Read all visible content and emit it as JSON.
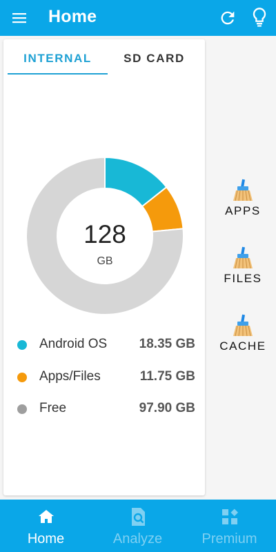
{
  "header": {
    "title": "Home",
    "menu_icon": "menu-icon",
    "refresh_icon": "refresh-icon",
    "tips_icon": "lightbulb-icon",
    "color": "#0aa7e8"
  },
  "tabs": [
    {
      "label": "INTERNAL",
      "active": true
    },
    {
      "label": "SD CARD",
      "active": false
    }
  ],
  "storage": {
    "total": "128",
    "unit": "GB",
    "segments": [
      {
        "name": "Android OS",
        "value": "18.35 GB",
        "gb": 18.35,
        "color": "#18b8d6"
      },
      {
        "name": "Apps/Files",
        "value": "11.75 GB",
        "gb": 11.75,
        "color": "#f59a0c"
      },
      {
        "name": "Free",
        "value": "97.90 GB",
        "gb": 97.9,
        "color": "#d6d6d6",
        "dot_color": "#9e9e9e"
      }
    ]
  },
  "clean_actions": [
    {
      "label": "APPS",
      "icon": "broom-icon"
    },
    {
      "label": "FILES",
      "icon": "broom-icon"
    },
    {
      "label": "CACHE",
      "icon": "broom-icon"
    }
  ],
  "bottom_nav": [
    {
      "label": "Home",
      "icon": "home-icon",
      "active": true
    },
    {
      "label": "Analyze",
      "icon": "analyze-icon",
      "active": false
    },
    {
      "label": "Premium",
      "icon": "premium-icon",
      "active": false
    }
  ]
}
